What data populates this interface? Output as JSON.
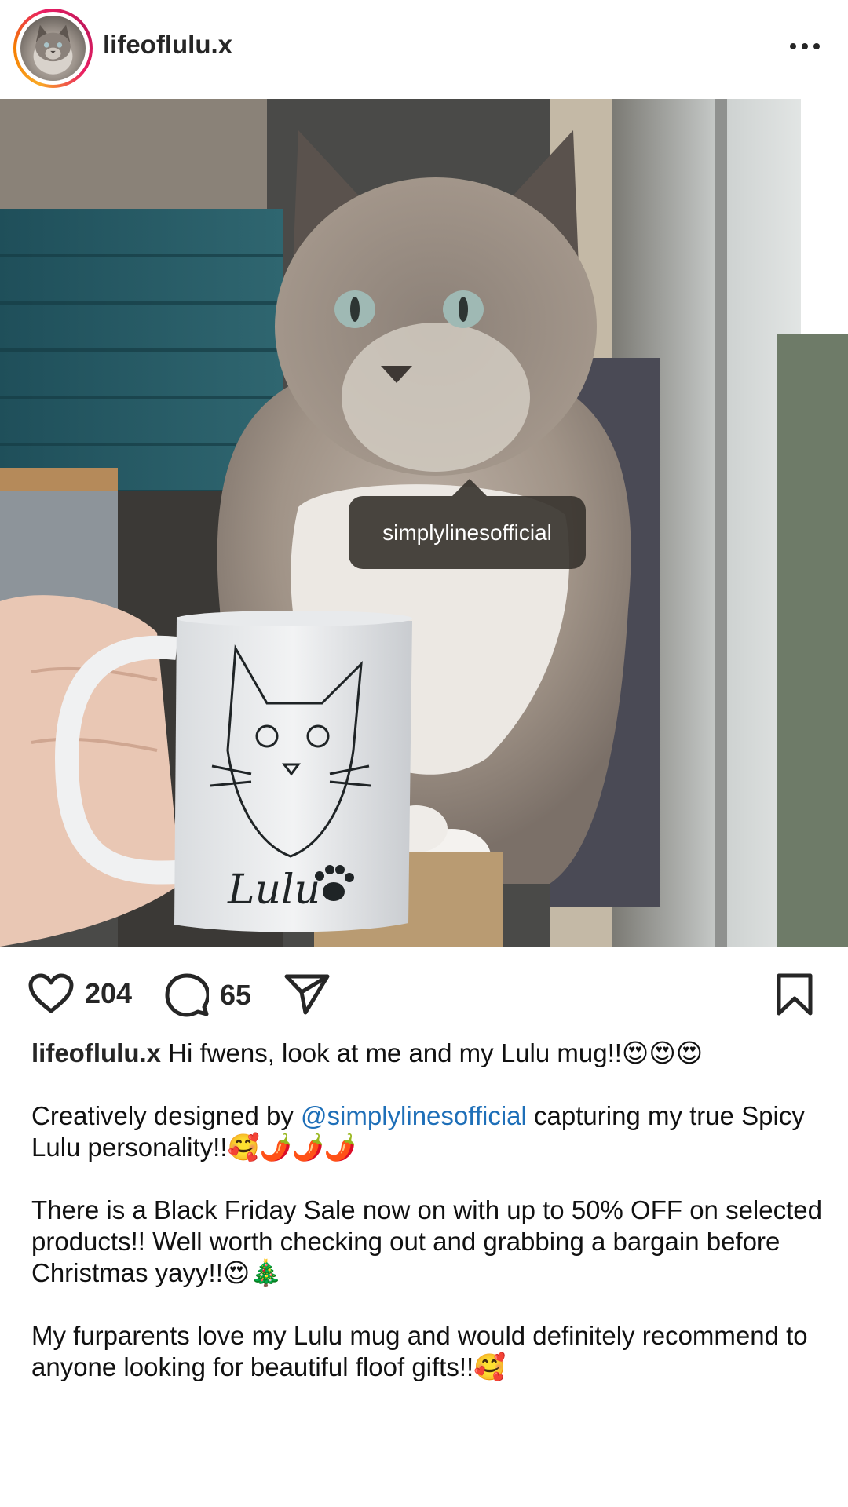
{
  "post": {
    "username": "lifeoflulu.x",
    "more_icon": "more-horizontal-icon",
    "photo": {
      "tag_label": "simplylinesofficial",
      "mug_text": "Lulu"
    },
    "actions": {
      "like_count": "204",
      "comment_count": "65"
    },
    "caption": {
      "username": "lifeoflulu.x",
      "line1": " Hi fwens, look at me and my Lulu mug!!😍😍😍",
      "p2_before": "Creatively designed by ",
      "p2_mention": "@simplylinesofficial",
      "p2_after": " capturing my true Spicy Lulu personality!!🥰🌶️🌶️🌶️",
      "p3": "There is a Black Friday Sale now on with up to 50% OFF on selected products!! Well worth checking out and grabbing a bargain before Christmas yayy!!😍🎄",
      "p4": "My furparents love my Lulu mug and would definitely recommend to anyone looking for beautiful floof gifts!!🥰"
    }
  },
  "colors": {
    "text": "#262626",
    "mention": "#1e6fb8",
    "tag_bg": "#3a3530"
  }
}
